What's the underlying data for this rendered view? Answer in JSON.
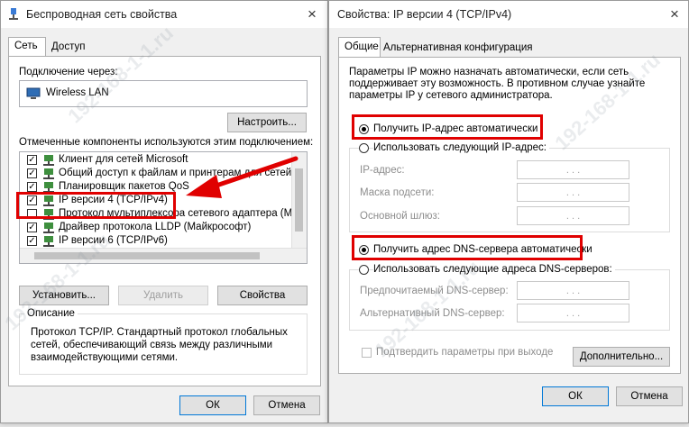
{
  "left_window": {
    "title": "Беспроводная сеть свойства",
    "tabs": [
      "Сеть",
      "Доступ"
    ],
    "connect_via_label": "Подключение через:",
    "adapter_name": "Wireless LAN",
    "configure_button": "Настроить...",
    "components_label": "Отмеченные компоненты используются этим подключением:",
    "components": [
      {
        "label": "Клиент для сетей Microsoft",
        "checked": true
      },
      {
        "label": "Общий доступ к файлам и принтерам для сетей Mi",
        "checked": true
      },
      {
        "label": "Планировщик пакетов QoS",
        "checked": true
      },
      {
        "label": "IP версии 4 (TCP/IPv4)",
        "checked": true
      },
      {
        "label": "Протокол мультиплексора сетевого адаптера (Майк",
        "checked": false
      },
      {
        "label": "Драйвер протокола LLDP (Майкрософт)",
        "checked": true
      },
      {
        "label": "IP версии 6 (TCP/IPv6)",
        "checked": true
      }
    ],
    "install_button": "Установить...",
    "remove_button": "Удалить",
    "properties_button": "Свойства",
    "description_label": "Описание",
    "description_text": [
      "Протокол TCP/IP. Стандартный протокол глобальных",
      "сетей, обеспечивающий связь между различными",
      "взаимодействующими сетями."
    ],
    "ok_button": "ОК",
    "cancel_button": "Отмена"
  },
  "right_window": {
    "title": "Свойства: IP версии 4 (TCP/IPv4)",
    "tabs": [
      "Общие",
      "Альтернативная конфигурация"
    ],
    "intro_text": [
      "Параметры IP можно назначать автоматически, если сеть",
      "поддерживает эту возможность. В противном случае узнайте",
      "параметры IP у сетевого администратора."
    ],
    "auto_ip_option": "Получить IP-адрес автоматически",
    "manual_ip_option": "Использовать следующий IP-адрес:",
    "ip_address_label": "IP-адрес:",
    "subnet_mask_label": "Маска подсети:",
    "gateway_label": "Основной шлюз:",
    "auto_dns_option": "Получить адрес DNS-сервера автоматически",
    "manual_dns_option": "Использовать следующие адреса DNS-серверов:",
    "preferred_dns_label": "Предпочитаемый DNS-сервер:",
    "alternate_dns_label": "Альтернативный DNS-сервер:",
    "validate_checkbox": "Подтвердить параметры при выходе",
    "advanced_button": "Дополнительно...",
    "ok_button": "ОК",
    "cancel_button": "Отмена",
    "ip_dots": ". . ."
  },
  "watermark": "192-168-1-1.ru",
  "icons": {
    "close": "×",
    "check": "✓"
  },
  "colors": {
    "highlight": "#e00000",
    "focus": "#0078d7"
  }
}
